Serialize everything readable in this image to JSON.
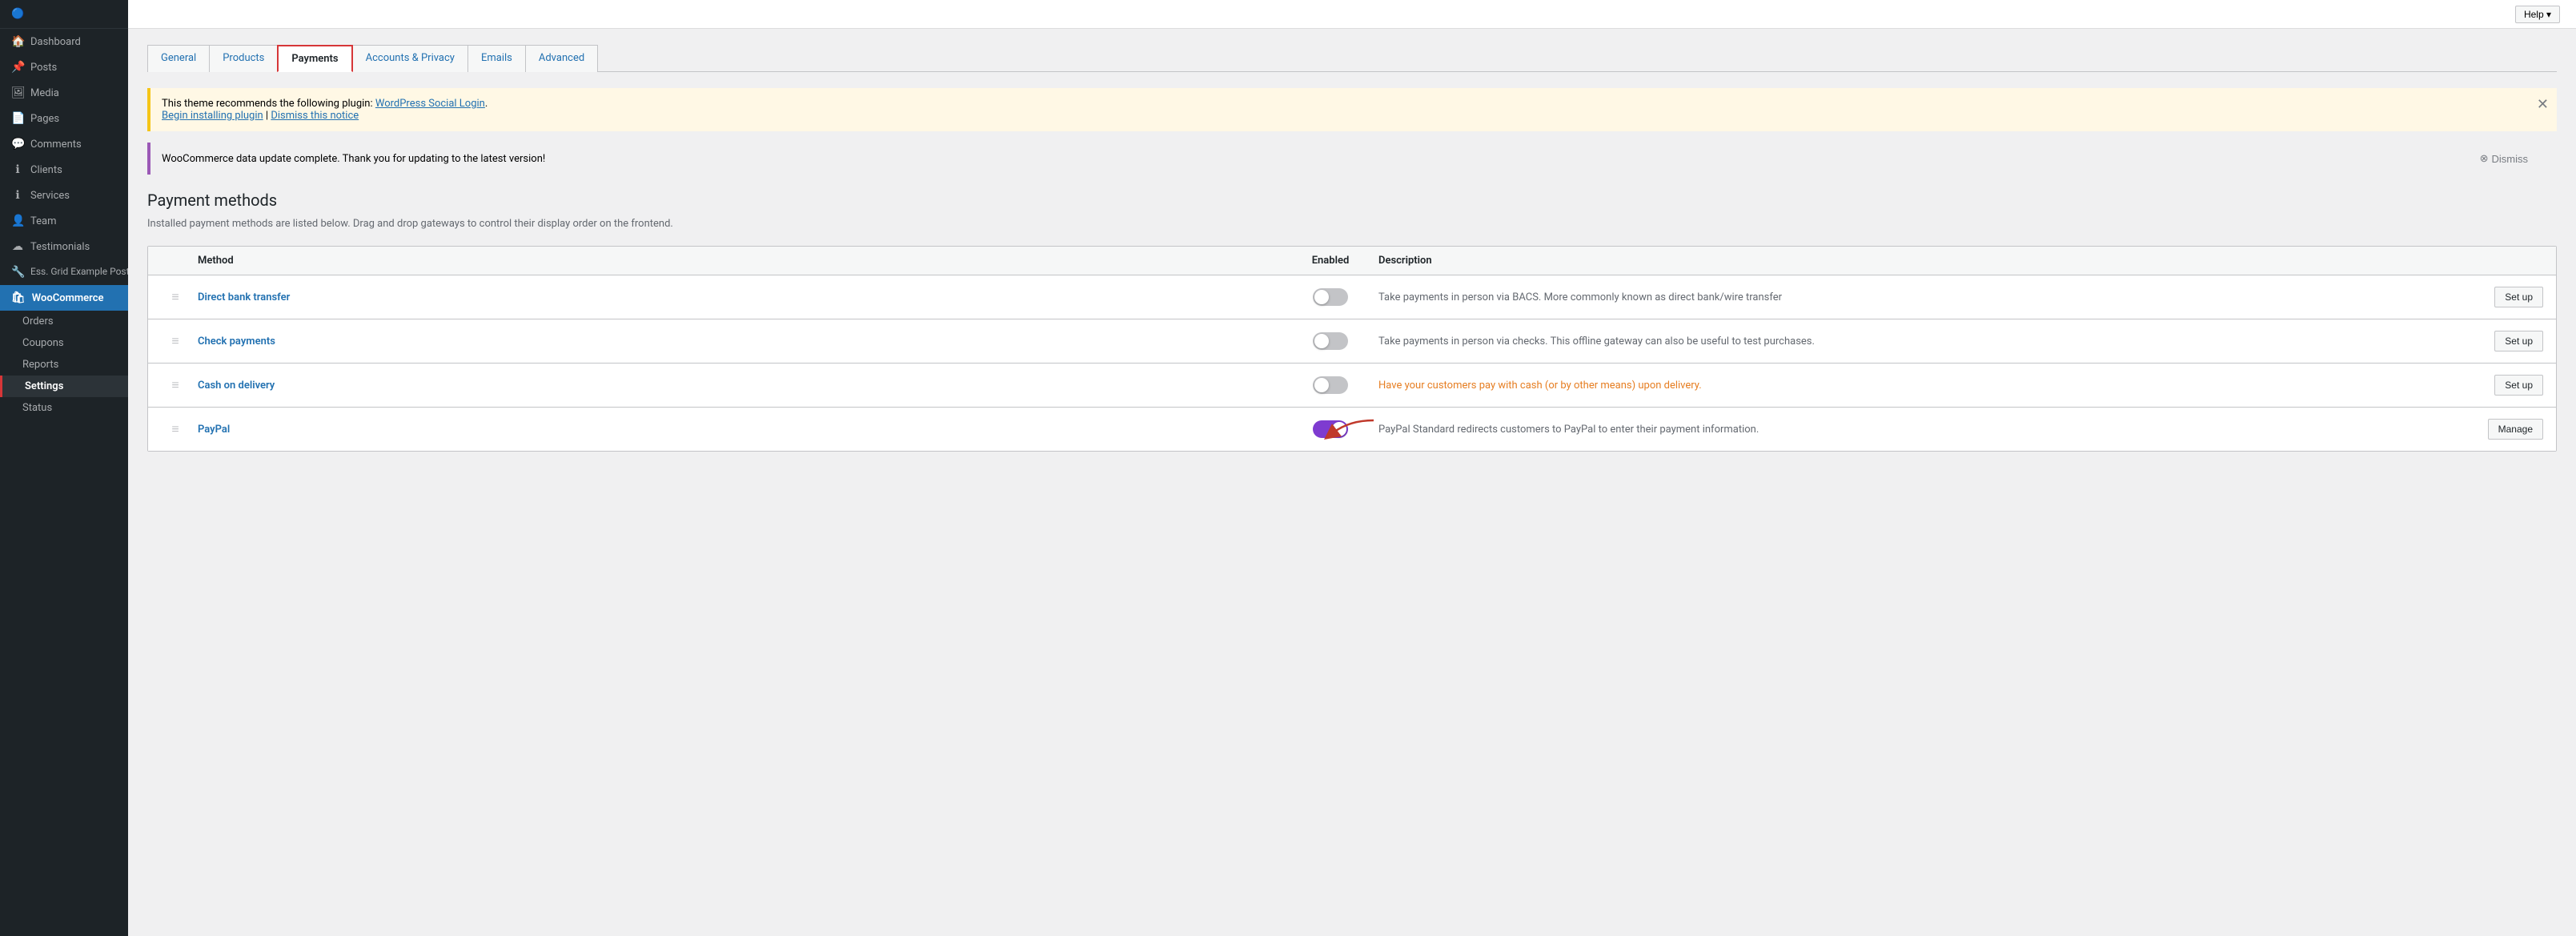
{
  "sidebar": {
    "items": [
      {
        "label": "Dashboard",
        "icon": "🏠",
        "name": "dashboard"
      },
      {
        "label": "Posts",
        "icon": "📌",
        "name": "posts"
      },
      {
        "label": "Media",
        "icon": "🖼",
        "name": "media"
      },
      {
        "label": "Pages",
        "icon": "📄",
        "name": "pages"
      },
      {
        "label": "Comments",
        "icon": "💬",
        "name": "comments"
      },
      {
        "label": "Clients",
        "icon": "ℹ",
        "name": "clients"
      },
      {
        "label": "Services",
        "icon": "ℹ",
        "name": "services"
      },
      {
        "label": "Team",
        "icon": "👤",
        "name": "team"
      },
      {
        "label": "Testimonials",
        "icon": "☁",
        "name": "testimonials"
      },
      {
        "label": "Ess. Grid Example Posts",
        "icon": "🔧",
        "name": "ess-grid"
      }
    ],
    "woocommerce_label": "WooCommerce",
    "sub_items": [
      {
        "label": "Orders",
        "name": "orders"
      },
      {
        "label": "Coupons",
        "name": "coupons"
      },
      {
        "label": "Reports",
        "name": "reports"
      },
      {
        "label": "Settings",
        "name": "settings",
        "active": true
      },
      {
        "label": "Status",
        "name": "status"
      }
    ]
  },
  "topbar": {
    "help_label": "Help ▾"
  },
  "tabs": [
    {
      "label": "General",
      "name": "general",
      "active": false
    },
    {
      "label": "Products",
      "name": "products",
      "active": false
    },
    {
      "label": "Payments",
      "name": "payments",
      "active": true
    },
    {
      "label": "Accounts & Privacy",
      "name": "accounts-privacy",
      "active": false
    },
    {
      "label": "Emails",
      "name": "emails",
      "active": false
    },
    {
      "label": "Advanced",
      "name": "advanced",
      "active": false
    }
  ],
  "notice_yellow": {
    "text1": "This theme recommends the following plugin: ",
    "link_text": "WordPress Social Login",
    "text2": ".",
    "begin_label": "Begin installing plugin",
    "separator": " | ",
    "dismiss_label": "Dismiss this notice"
  },
  "notice_purple": {
    "text": "WooCommerce data update complete. Thank you for updating to the latest version!",
    "dismiss_label": "Dismiss"
  },
  "section": {
    "title": "Payment methods",
    "description": "Installed payment methods are listed below. Drag and drop gateways to control their display order on the frontend."
  },
  "table": {
    "headers": {
      "method": "Method",
      "enabled": "Enabled",
      "description": "Description"
    },
    "rows": [
      {
        "name": "Direct bank transfer",
        "enabled": false,
        "description": "Take payments in person via BACS. More commonly known as direct bank/wire transfer",
        "action_label": "Set up",
        "desc_orange": false
      },
      {
        "name": "Check payments",
        "enabled": false,
        "description": "Take payments in person via checks. This offline gateway can also be useful to test purchases.",
        "action_label": "Set up",
        "desc_orange": false
      },
      {
        "name": "Cash on delivery",
        "enabled": false,
        "description": "Have your customers pay with cash (or by other means) upon delivery.",
        "action_label": "Set up",
        "desc_orange": true
      },
      {
        "name": "PayPal",
        "enabled": true,
        "description": "PayPal Standard redirects customers to PayPal to enter their payment information.",
        "action_label": "Manage",
        "desc_orange": false
      }
    ]
  }
}
